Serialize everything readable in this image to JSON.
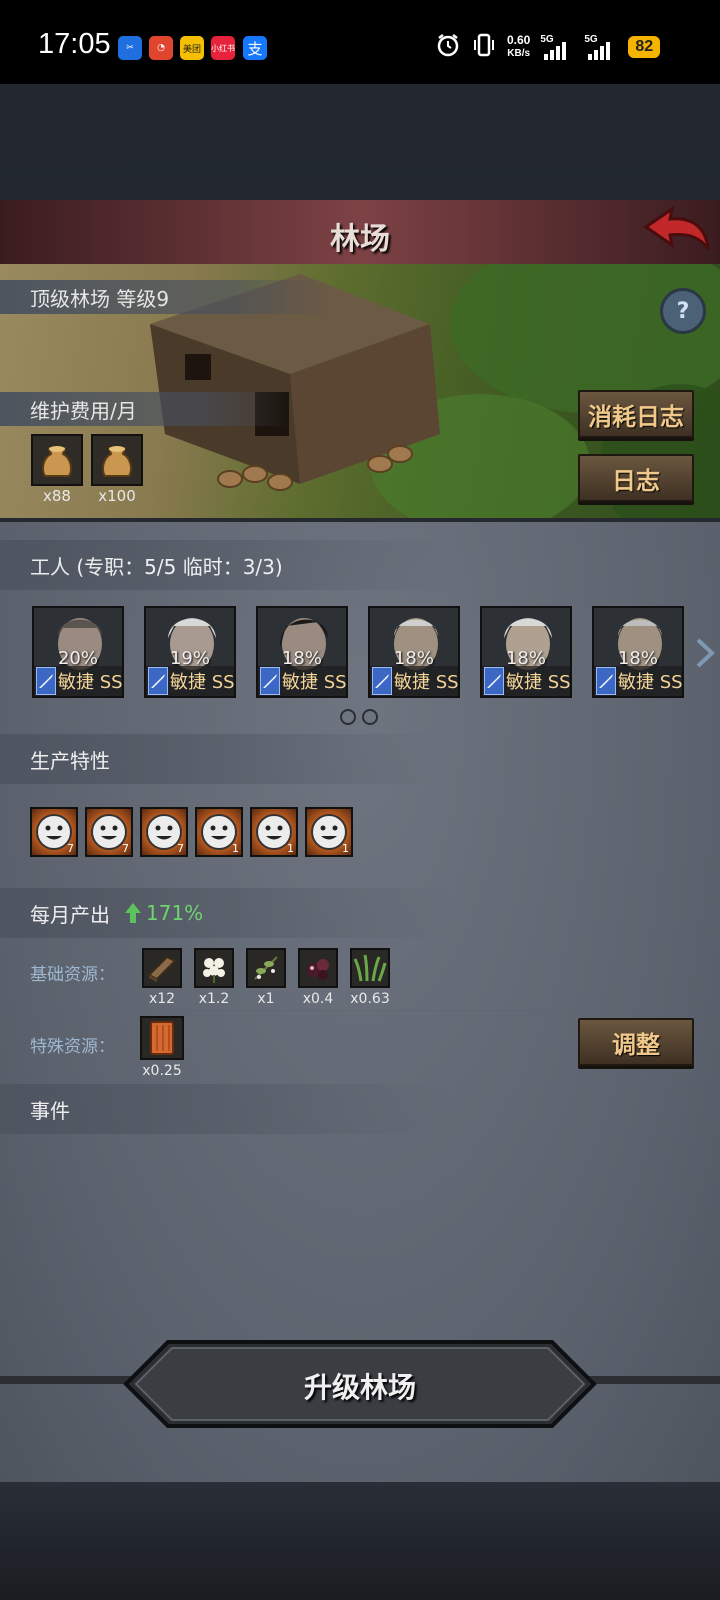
{
  "status_bar": {
    "time": "17:05",
    "apps": [
      {
        "icon": "app-blue-icon",
        "label": "✂",
        "color": "#1f6fe0"
      },
      {
        "icon": "app-red-icon",
        "label": "◔",
        "color": "#e0462f"
      },
      {
        "icon": "meituan-icon",
        "label": "美团",
        "color": "#f6c000"
      },
      {
        "icon": "xiaohongshu-icon",
        "label": "小红书",
        "color": "#e8223a"
      },
      {
        "icon": "alipay-icon",
        "label": "支",
        "color": "#1677ff"
      }
    ],
    "speed_value": "0.60",
    "speed_unit": "KB/s",
    "sim1": "5G",
    "sim2": "5G",
    "battery": "82"
  },
  "header": {
    "title": "林场",
    "back_icon": "back-arrow-icon"
  },
  "banner": {
    "building_label": "顶级林场 等级9",
    "help_icon": "question-icon",
    "upkeep_label": "维护费用/月",
    "upkeep": [
      {
        "icon": "grain-sack-icon",
        "qty": "x88"
      },
      {
        "icon": "grain-sack-icon",
        "qty": "x100"
      }
    ],
    "consume_log_button": "消耗日志",
    "log_button": "日志"
  },
  "workers_section": {
    "title": "工人 (专职：5/5 临时：3/3)",
    "workers": [
      {
        "pct": "20%",
        "skill": "敏捷 SS"
      },
      {
        "pct": "19%",
        "skill": "敏捷 SS"
      },
      {
        "pct": "18%",
        "skill": "敏捷 SS"
      },
      {
        "pct": "18%",
        "skill": "敏捷 SS"
      },
      {
        "pct": "18%",
        "skill": "敏捷 SS"
      },
      {
        "pct": "18%",
        "skill": "敏捷 SS"
      }
    ],
    "next_icon": "chevron-right-icon"
  },
  "traits_section": {
    "title": "生产特性",
    "traits": [
      {
        "icon": "smiley-icon",
        "count": "7"
      },
      {
        "icon": "smiley-icon",
        "count": "7"
      },
      {
        "icon": "smiley-icon",
        "count": "7"
      },
      {
        "icon": "smiley-icon",
        "count": "1"
      },
      {
        "icon": "smiley-icon",
        "count": "1"
      },
      {
        "icon": "smiley-icon",
        "count": "1"
      }
    ]
  },
  "output_section": {
    "title": "每月产出",
    "growth": "171%",
    "growth_icon": "arrow-up-icon",
    "basic_label": "基础资源：",
    "basic": [
      {
        "icon": "wood-plank-icon",
        "qty": "x12"
      },
      {
        "icon": "white-flower-icon",
        "qty": "x1.2"
      },
      {
        "icon": "herb-sprig-icon",
        "qty": "x1"
      },
      {
        "icon": "berries-icon",
        "qty": "x0.4"
      },
      {
        "icon": "grass-icon",
        "qty": "x0.63"
      }
    ],
    "special_label": "特殊资源：",
    "special": [
      {
        "icon": "bark-icon",
        "qty": "x0.25"
      }
    ],
    "adjust_button": "调整"
  },
  "events_section": {
    "title": "事件"
  },
  "upgrade_button": "升级林场",
  "colors": {
    "accent_wood": "#f0c98a",
    "growth_green": "#6fd36f",
    "header_red": "#7d4245"
  }
}
